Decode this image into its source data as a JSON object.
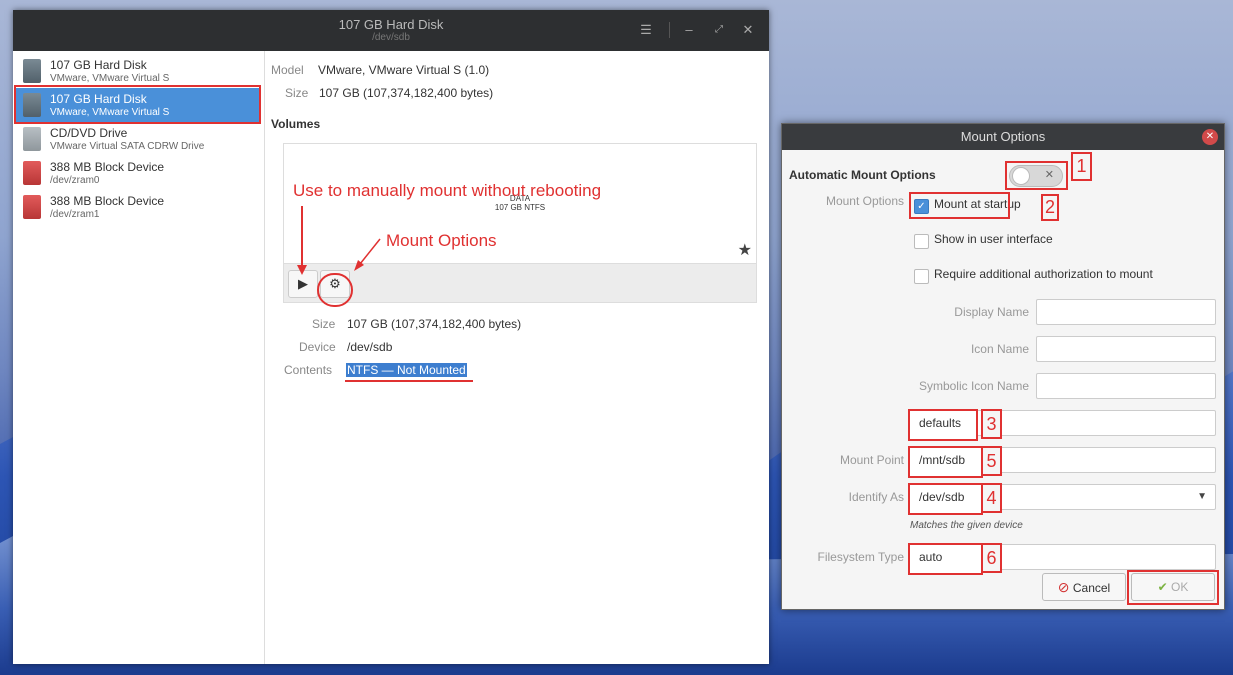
{
  "window": {
    "title": "107 GB Hard Disk",
    "subtitle": "/dev/sdb"
  },
  "sidebar": {
    "items": [
      {
        "name": "107 GB Hard Disk",
        "sub": "VMware, VMware Virtual S",
        "icon": "hard-disk-icon"
      },
      {
        "name": "107 GB Hard Disk",
        "sub": "VMware, VMware Virtual S",
        "icon": "hard-disk-icon",
        "selected": true
      },
      {
        "name": "CD/DVD Drive",
        "sub": "VMware Virtual SATA CDRW Drive",
        "icon": "optical-drive-icon"
      },
      {
        "name": "388 MB Block Device",
        "sub": "/dev/zram0",
        "icon": "block-device-icon"
      },
      {
        "name": "388 MB Block Device",
        "sub": "/dev/zram1",
        "icon": "block-device-icon"
      }
    ]
  },
  "details": {
    "model_label": "Model",
    "model_value": "VMware, VMware Virtual S (1.0)",
    "size_label": "Size",
    "size_value": "107 GB (107,374,182,400 bytes)",
    "volumes_label": "Volumes",
    "volume": {
      "name": "DATA",
      "desc": "107 GB NTFS"
    },
    "vol_size_label": "Size",
    "vol_size_value": "107 GB (107,374,182,400 bytes)",
    "device_label": "Device",
    "device_value": "/dev/sdb",
    "contents_label": "Contents",
    "contents_value": "NTFS — Not Mounted"
  },
  "annotations": {
    "mount_hint": "Use to manually mount without rebooting",
    "mount_options": "Mount Options"
  },
  "dialog": {
    "title": "Mount Options",
    "auto_label": "Automatic Mount Options",
    "mount_options_label": "Mount Options",
    "mount_at_startup": "Mount at startup",
    "show_in_ui": "Show in user interface",
    "require_auth": "Require additional authorization to mount",
    "display_name_label": "Display Name",
    "icon_name_label": "Icon Name",
    "symbolic_icon_label": "Symbolic Icon Name",
    "options_value": "defaults",
    "mount_point_label": "Mount Point",
    "mount_point_value": "/mnt/sdb",
    "identify_as_label": "Identify As",
    "identify_as_value": "/dev/sdb",
    "matches_hint": "Matches the given device",
    "fs_type_label": "Filesystem Type",
    "fs_type_value": "auto",
    "cancel_label": "Cancel",
    "ok_label": "OK",
    "markers": [
      "1",
      "2",
      "3",
      "5",
      "4",
      "6"
    ]
  }
}
